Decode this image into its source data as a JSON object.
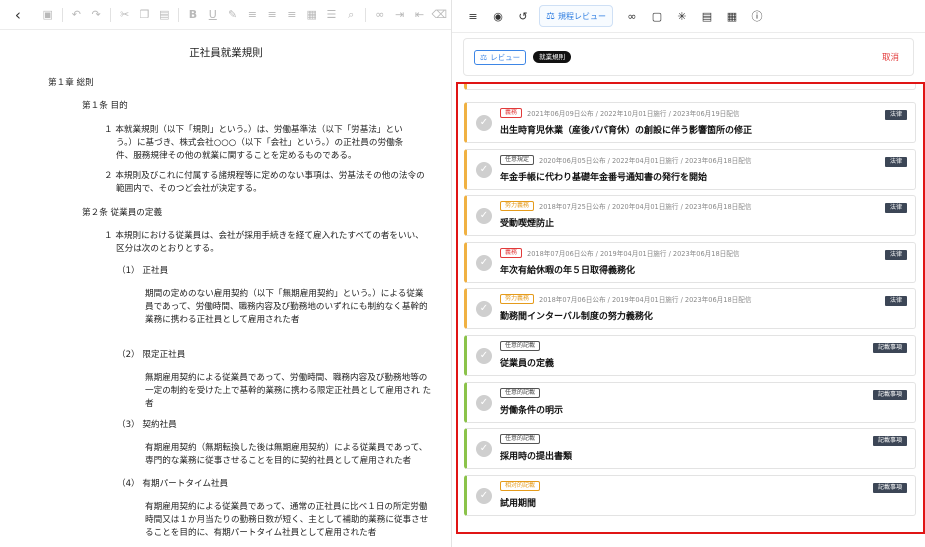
{
  "editor": {
    "title": "正社員就業規則",
    "chapter": "第１章  総則",
    "art1_heading": "第１条  目的",
    "art1_p1": [
      "１ 本就業規則（以下「規則」という。）は、労働基準法（以下「労基法」とい",
      "う。）に基づき、株式会社○○○（以下「会社」という。）の正社員の労働条",
      "件、服務規律その他の就業に関することを定めるものである。"
    ],
    "art1_p2": [
      "２ 本規則及びこれに付属する諸規程等に定めのない事項は、労基法その他の法令の",
      "範囲内で、そのつど会社が決定する。"
    ],
    "art2_heading": "第２条  従業員の定義",
    "art2_p1": [
      "１ 本規則における従業員は、会社が採用手続きを経て雇入れたすべての者をいい、",
      "区分は次のとおりとする。"
    ],
    "items": [
      {
        "label": "（1）  正社員",
        "lines": [
          "期間の定めのない雇用契約（以下「無期雇用契約」という。）による従業",
          "員であって、労働時間、職務内容及び勤務地のいずれにも制約なく基幹的",
          "業務に携わる正社員として雇用された者"
        ]
      },
      {
        "label": "（2）  限定正社員",
        "lines": [
          "無期雇用契約による従業員であって、労働時間、職務内容及び勤務地等の",
          "一定の制約を受けた上で基幹的業務に携わる限定正社員として雇用され た",
          "者"
        ]
      },
      {
        "label": "（3）  契約社員",
        "lines": [
          "有期雇用契約（無期転換した後は無期雇用契約）による従業員であって、",
          "専門的な業務に従事させることを目的に契約社員として雇用された者"
        ]
      },
      {
        "label": "（4）  有期パートタイム社員",
        "lines": [
          "有期雇用契約による従業員であって、通常の正社員に比べ１日の所定労働",
          "時間又は１か月当たりの勤務日数が短く、主として補助的業務に従事させ",
          "ることを目的に、有期パートタイム社員として雇用された者"
        ]
      }
    ]
  },
  "right": {
    "active_tab": "規程レビュー",
    "review_button": "レビュー",
    "tag": "就業規則",
    "cancel": "取消",
    "cards": [
      {
        "badge": "義務",
        "badge_color": "red",
        "meta": "2021年06月09日公布 / 2022年10月01日施行 / 2023年06月19日配信",
        "title": "出生時育児休業（産後パパ育休）の創設に伴う影響箇所の修正",
        "category": "法律",
        "stripe": "orange"
      },
      {
        "badge": "任意規定",
        "badge_color": "dark",
        "meta": "2020年06月05日公布 / 2022年04月01日施行 / 2023年06月18日配信",
        "title": "年金手帳に代わり基礎年金番号通知書の発行を開始",
        "category": "法律",
        "stripe": "orange"
      },
      {
        "badge": "努力義務",
        "badge_color": "orange",
        "meta": "2018年07月25日公布 / 2020年04月01日施行 / 2023年06月18日配信",
        "title": "受動喫煙防止",
        "category": "法律",
        "stripe": "orange"
      },
      {
        "badge": "義務",
        "badge_color": "red",
        "meta": "2018年07月06日公布 / 2019年04月01日施行 / 2023年06月18日配信",
        "title": "年次有給休暇の年５日取得義務化",
        "category": "法律",
        "stripe": "orange"
      },
      {
        "badge": "努力義務",
        "badge_color": "orange",
        "meta": "2018年07月06日公布 / 2019年04月01日施行 / 2023年06月18日配信",
        "title": "勤務間インターバル制度の努力義務化",
        "category": "法律",
        "stripe": "orange"
      },
      {
        "badge": "任意的記載",
        "badge_color": "dark",
        "meta": "",
        "title": "従業員の定義",
        "category": "記載事項",
        "stripe": "green"
      },
      {
        "badge": "任意的記載",
        "badge_color": "dark",
        "meta": "",
        "title": "労働条件の明示",
        "category": "記載事項",
        "stripe": "green"
      },
      {
        "badge": "任意的記載",
        "badge_color": "dark",
        "meta": "",
        "title": "採用時の提出書類",
        "category": "記載事項",
        "stripe": "green"
      },
      {
        "badge": "相対的記載",
        "badge_color": "orange",
        "meta": "",
        "title": "試用期間",
        "category": "記載事項",
        "stripe": "green"
      }
    ]
  }
}
